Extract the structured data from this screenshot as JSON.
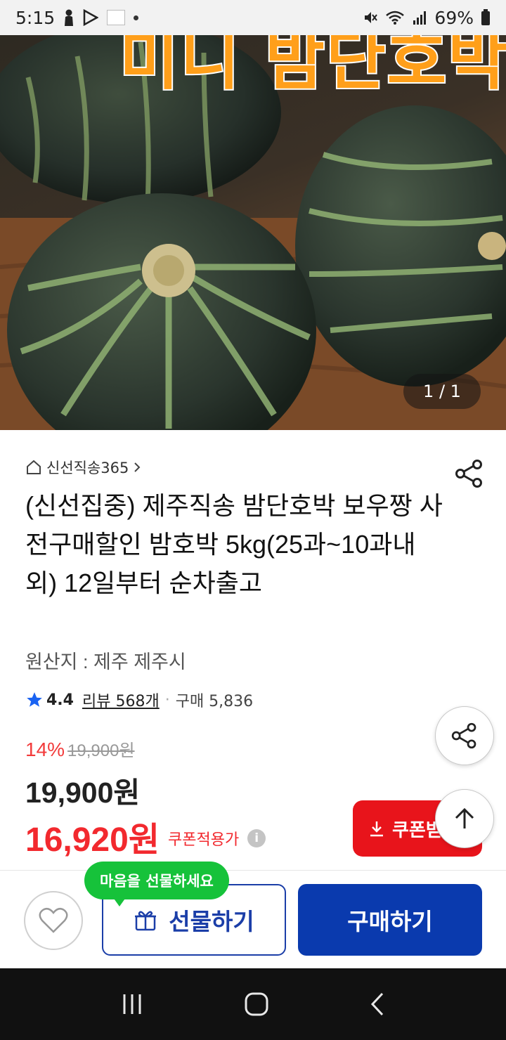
{
  "status_bar": {
    "time": "5:15",
    "battery": "69%"
  },
  "hero": {
    "banner_text": "미니 밤단호박",
    "image_counter": "1 / 1"
  },
  "product": {
    "store_breadcrumb": "신선직송365",
    "title": "(신선집중) 제주직송 밤단호박 보우짱 사전구매할인 밤호박 5kg(25과~10과내외) 12일부터 순차출고",
    "origin": "원산지 : 제주 제주시",
    "rating": "4.4",
    "review_label": "리뷰 568개",
    "purchase_label": "구매 5,836",
    "discount_rate": "14%",
    "original_price": "19,900원",
    "price": "19,900원",
    "coupon_price": "16,920원",
    "coupon_applied_label": "쿠폰적용가",
    "coupon_button_label": "쿠폰받"
  },
  "bottom_bar": {
    "tooltip": "마음을 선물하세요",
    "gift_button": "선물하기",
    "buy_button": "구매하기"
  },
  "colors": {
    "accent_red": "#e8141b",
    "buy_blue": "#0a3aae",
    "tooltip_green": "#16c23a"
  }
}
